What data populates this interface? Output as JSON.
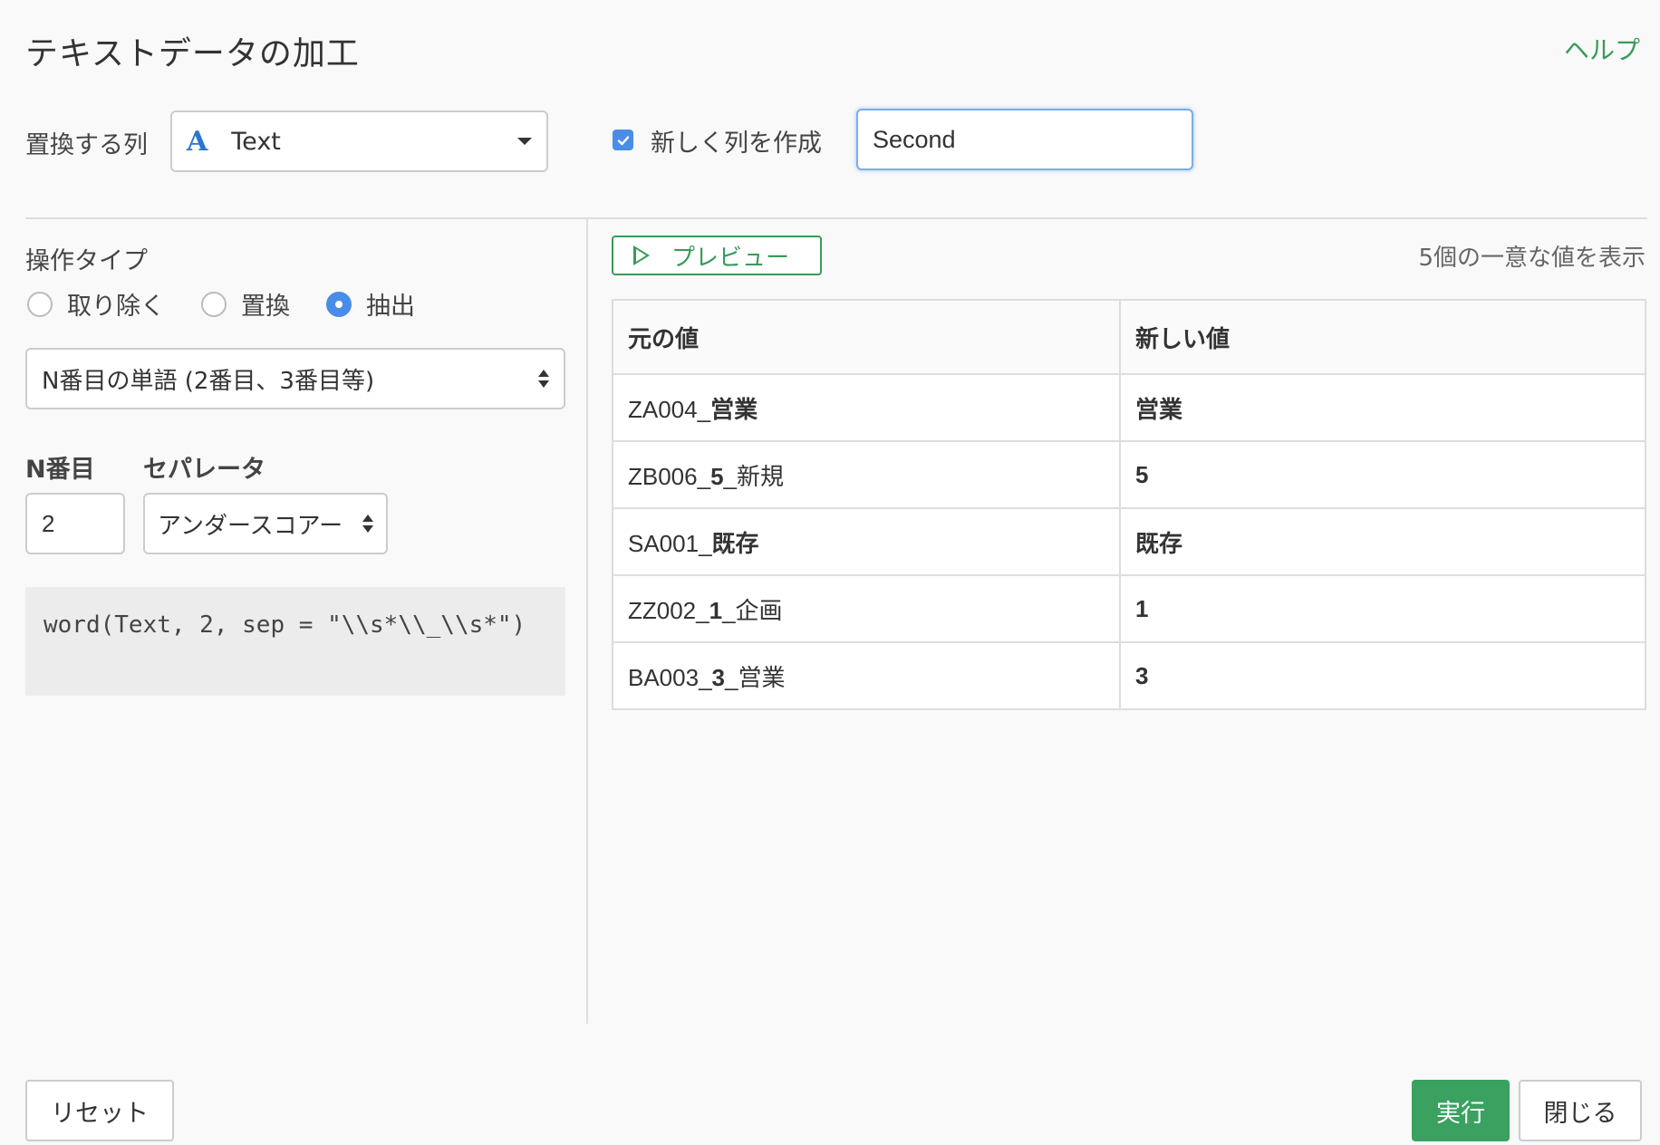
{
  "header": {
    "title": "テキストデータの加工",
    "help_label": "ヘルプ"
  },
  "target_column": {
    "label": "置換する列",
    "type_icon": "A",
    "value": "Text"
  },
  "new_column": {
    "checked": true,
    "label": "新しく列を作成",
    "value": "Second"
  },
  "operation": {
    "label": "操作タイプ",
    "options": [
      {
        "label": "取り除く",
        "checked": false
      },
      {
        "label": "置換",
        "checked": false
      },
      {
        "label": "抽出",
        "checked": true
      }
    ],
    "mode_value": "N番目の単語 (2番目、3番目等)"
  },
  "params": {
    "nth_label": "N番目",
    "nth_value": "2",
    "separator_label": "セパレータ",
    "separator_value": "アンダースコアー"
  },
  "code": "word(Text, 2, sep = \"\\\\s*\\\\_\\\\s*\")",
  "preview": {
    "button_label": "プレビュー",
    "unique_count_text": "5個の一意な値を表示",
    "headers": [
      "元の値",
      "新しい値"
    ],
    "rows": [
      {
        "orig_prefix": "ZA004_",
        "orig_hl": "営業",
        "orig_suffix": "",
        "new_value": "営業"
      },
      {
        "orig_prefix": "ZB006_",
        "orig_hl": "5",
        "orig_suffix": "_新規",
        "new_value": "5"
      },
      {
        "orig_prefix": "SA001_",
        "orig_hl": "既存",
        "orig_suffix": "",
        "new_value": "既存"
      },
      {
        "orig_prefix": "ZZ002_",
        "orig_hl": "1",
        "orig_suffix": "_企画",
        "new_value": "1"
      },
      {
        "orig_prefix": "BA003_",
        "orig_hl": "3",
        "orig_suffix": "_営業",
        "new_value": "3"
      }
    ]
  },
  "footer": {
    "reset_label": "リセット",
    "run_label": "実行",
    "close_label": "閉じる"
  },
  "colors": {
    "accent_green": "#3aa160",
    "checkbox_blue": "#4a8de8",
    "type_blue": "#2a78c8"
  }
}
